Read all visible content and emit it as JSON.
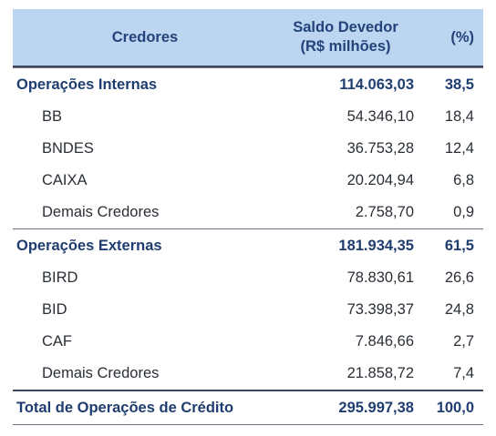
{
  "header": {
    "col1": "Credores",
    "col2_line1": "Saldo Devedor",
    "col2_line2": "(R$ milhões)",
    "col3": "(%)"
  },
  "groups": [
    {
      "label": "Operações Internas",
      "value": "114.063,03",
      "pct": "38,5",
      "items": [
        {
          "label": "BB",
          "value": "54.346,10",
          "pct": "18,4"
        },
        {
          "label": "BNDES",
          "value": "36.753,28",
          "pct": "12,4"
        },
        {
          "label": "CAIXA",
          "value": "20.204,94",
          "pct": "6,8"
        },
        {
          "label": "Demais Credores",
          "value": "2.758,70",
          "pct": "0,9"
        }
      ]
    },
    {
      "label": "Operações Externas",
      "value": "181.934,35",
      "pct": "61,5",
      "items": [
        {
          "label": "BIRD",
          "value": "78.830,61",
          "pct": "26,6"
        },
        {
          "label": "BID",
          "value": "73.398,37",
          "pct": "24,8"
        },
        {
          "label": "CAF",
          "value": "7.846,66",
          "pct": "2,7"
        },
        {
          "label": "Demais Credores",
          "value": "21.858,72",
          "pct": "7,4"
        }
      ]
    }
  ],
  "total": {
    "label": "Total de Operações de Crédito",
    "value": "295.997,38",
    "pct": "100,0"
  }
}
